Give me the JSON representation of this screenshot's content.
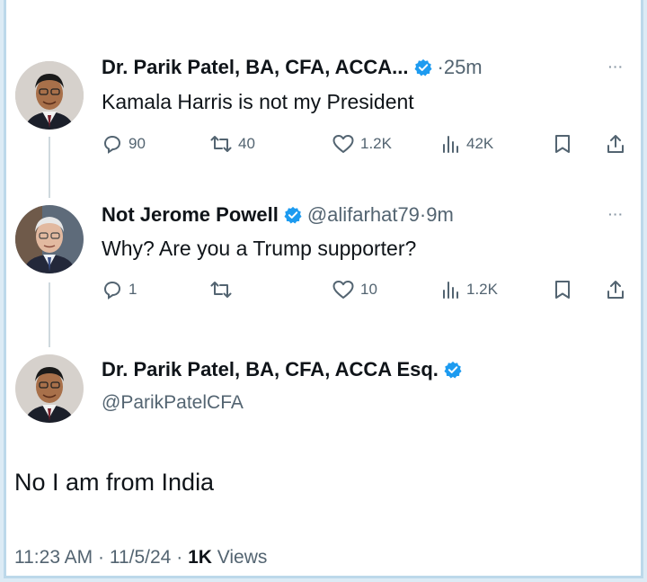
{
  "tweet1": {
    "author": "Dr. Parik Patel, BA, CFA, ACCA...",
    "time": "25m",
    "text": "Kamala Harris is not my President",
    "stats": {
      "replies": "90",
      "reposts": "40",
      "likes": "1.2K",
      "views": "42K"
    }
  },
  "tweet2": {
    "author": "Not Jerome Powell",
    "handle": "@alifarhat79",
    "time": "9m",
    "text": "Why? Are you a Trump supporter?",
    "stats": {
      "replies": "1",
      "reposts": "",
      "likes": "10",
      "views": "1.2K"
    }
  },
  "tweet3": {
    "author": "Dr. Parik Patel, BA, CFA, ACCA Esq.",
    "handle": "@ParikPatelCFA",
    "text": "No I am from India",
    "time": "11:23 AM",
    "date": "11/5/24",
    "views_count": "1K",
    "views_label": "Views"
  },
  "separator": "·",
  "more_label": "···",
  "colors": {
    "verified": "#1d9bf0",
    "icon": "#536471",
    "text": "#0f1419",
    "frame": "#bcd8ea"
  },
  "icons": [
    "verified-badge-icon",
    "reply-icon",
    "repost-icon",
    "like-icon",
    "views-icon",
    "bookmark-icon",
    "share-icon",
    "more-icon"
  ]
}
